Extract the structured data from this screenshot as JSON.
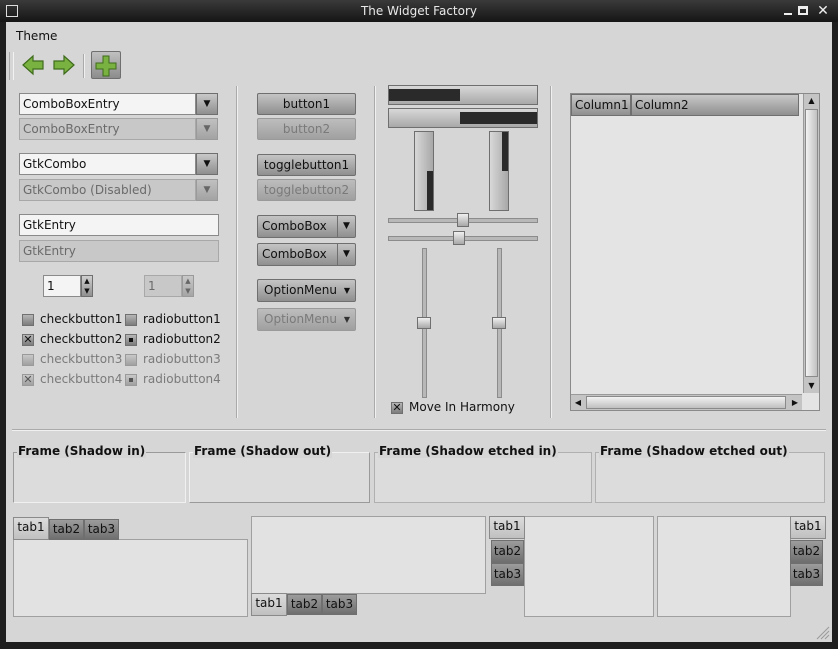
{
  "window": {
    "title": "The Widget Factory"
  },
  "menu": {
    "theme": "Theme"
  },
  "col1": {
    "comboentry1": "ComboBoxEntry",
    "comboentry2": "ComboBoxEntry",
    "combo1": "GtkCombo",
    "combo2": "GtkCombo (Disabled)",
    "entry1": "GtkEntry",
    "entry2": "GtkEntry",
    "spin1": "1",
    "spin2": "1",
    "checks": [
      "checkbutton1",
      "checkbutton2",
      "checkbutton3",
      "checkbutton4"
    ],
    "radios": [
      "radiobutton1",
      "radiobutton2",
      "radiobutton3",
      "radiobutton4"
    ]
  },
  "col2": {
    "button1": "button1",
    "button2": "button2",
    "toggle1": "togglebutton1",
    "toggle2": "togglebutton2",
    "combobox1": "ComboBox",
    "combobox2": "ComboBox",
    "option1": "OptionMenu",
    "option2": "OptionMenu"
  },
  "col3": {
    "harmony": "Move In Harmony",
    "progress_h": [
      0.48,
      0.52
    ],
    "progress_v": [
      0.5,
      0.5
    ],
    "slider_h": [
      0.5,
      0.47
    ],
    "slider_v": [
      0.5,
      0.5
    ]
  },
  "tree": {
    "columns": [
      "Column1",
      "Column2"
    ]
  },
  "frames": [
    "Frame (Shadow in)",
    "Frame (Shadow out)",
    "Frame (Shadow etched in)",
    "Frame (Shadow etched out)"
  ],
  "notebook": {
    "tabs": [
      "tab1",
      "tab2",
      "tab3"
    ]
  },
  "arrows": {
    "down": "▼",
    "up": "▲",
    "left": "◀",
    "right": "▶",
    "check": "✕"
  }
}
